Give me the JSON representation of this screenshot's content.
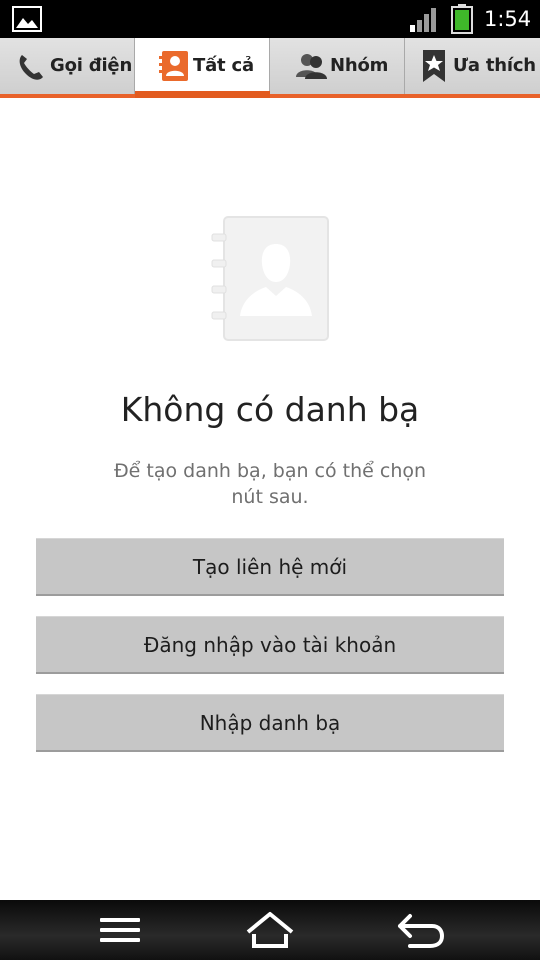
{
  "status_bar": {
    "time": "1:54",
    "icons": [
      "gallery-icon",
      "signal-icon",
      "battery-icon"
    ]
  },
  "tabs": [
    {
      "label": "Gọi điện",
      "icon": "phone-icon",
      "active": false
    },
    {
      "label": "Tất cả",
      "icon": "contact-card-icon",
      "active": true
    },
    {
      "label": "Nhóm",
      "icon": "group-icon",
      "active": false
    },
    {
      "label": "Ưa thích",
      "icon": "star-bookmark-icon",
      "active": false
    }
  ],
  "empty_state": {
    "icon": "contact-book-icon",
    "title": "Không có danh bạ",
    "subtitle": "Để tạo danh bạ, bạn có thể chọn nút sau."
  },
  "actions": [
    {
      "label": "Tạo liên hệ mới"
    },
    {
      "label": "Đăng nhập vào tài khoản"
    },
    {
      "label": "Nhập danh bạ"
    }
  ],
  "nav_bar": {
    "icons": [
      "menu-icon",
      "home-icon",
      "back-icon"
    ]
  },
  "colors": {
    "accent": "#e8622a",
    "tab_bg": "#d6d6d6",
    "button_bg": "#c6c6c6"
  }
}
